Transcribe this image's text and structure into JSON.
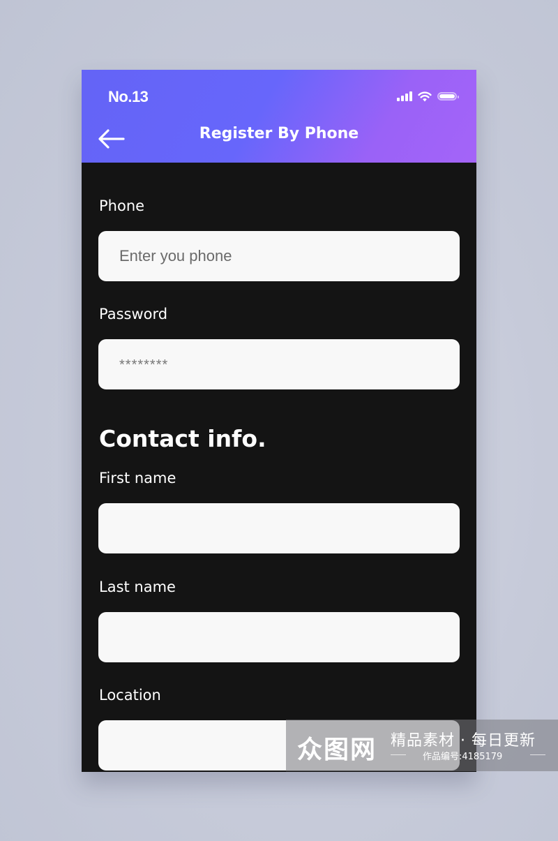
{
  "status_bar": {
    "time": "No.13",
    "icons": [
      "signal-icon",
      "wifi-icon",
      "battery-icon"
    ]
  },
  "nav": {
    "back_icon": "arrow-left-icon",
    "title": "Register By Phone"
  },
  "colors": {
    "header_gradient_start": "#6464f6",
    "header_gradient_end": "#a464f8",
    "screen_background": "#141414",
    "input_background": "#f8f8f8",
    "page_background": "#c6cad9"
  },
  "form": {
    "phone": {
      "label": "Phone",
      "placeholder": "Enter you phone",
      "value": ""
    },
    "password": {
      "label": "Password",
      "placeholder": "********",
      "value": ""
    },
    "contact_section_title": "Contact info.",
    "first_name": {
      "label": "First name",
      "value": ""
    },
    "last_name": {
      "label": "Last name",
      "value": ""
    },
    "location": {
      "label": "Location",
      "value": ""
    }
  },
  "watermark": {
    "logo": "众图网",
    "slogan": "精品素材 · 每日更新",
    "id_text": "作品编号:4185179"
  }
}
